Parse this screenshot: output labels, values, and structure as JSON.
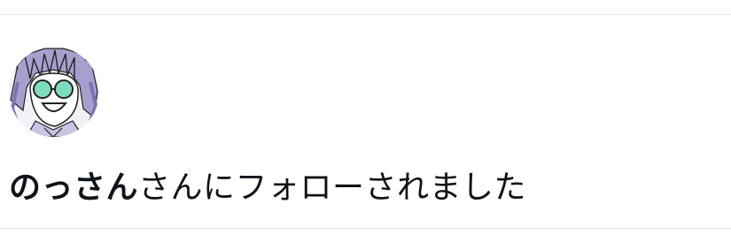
{
  "notification": {
    "user_name": "のっさん",
    "action_text": "さんにフォローされました"
  },
  "avatar": {
    "icon": "anime-avatar-icon",
    "colors": {
      "hair": "#a7a0cf",
      "hair_shade": "#7d73b3",
      "glasses": "#7fdcc0",
      "skin": "#ffffff",
      "outline": "#222222"
    }
  },
  "theme": {
    "text": "#0f1419",
    "divider": "#e6e8ee",
    "background": "#ffffff"
  }
}
